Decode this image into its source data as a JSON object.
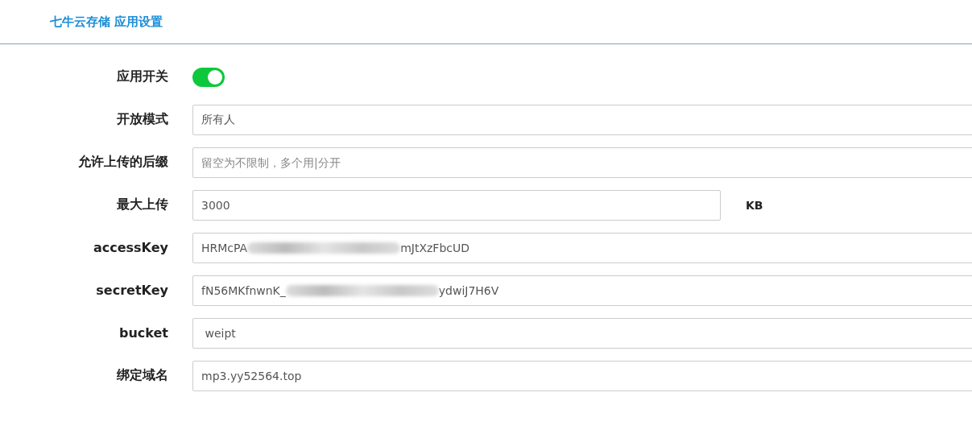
{
  "header": {
    "title": "七牛云存储 应用设置"
  },
  "fields": [
    {
      "kind": "toggle",
      "label": "应用开关",
      "on": true
    },
    {
      "kind": "text",
      "label": "开放模式",
      "value": "所有人"
    },
    {
      "kind": "text",
      "label": "允许上传的后缀",
      "placeholder": "留空为不限制，多个用|分开"
    },
    {
      "kind": "text",
      "label": "最大上传",
      "value": "3000",
      "unit": "KB"
    },
    {
      "kind": "redacted",
      "label": "accessKey",
      "value_start": "HRMcPA",
      "value_end": "mJtXzFbcUD"
    },
    {
      "kind": "redacted",
      "label": "secretKey",
      "value_start": "fN56MKfnwnK_",
      "value_end": "ydwiJ7H6V"
    },
    {
      "kind": "text",
      "label": "bucket",
      "value": " weipt"
    },
    {
      "kind": "text",
      "label": "绑定域名",
      "value": "mp3.yy52564.top"
    }
  ]
}
